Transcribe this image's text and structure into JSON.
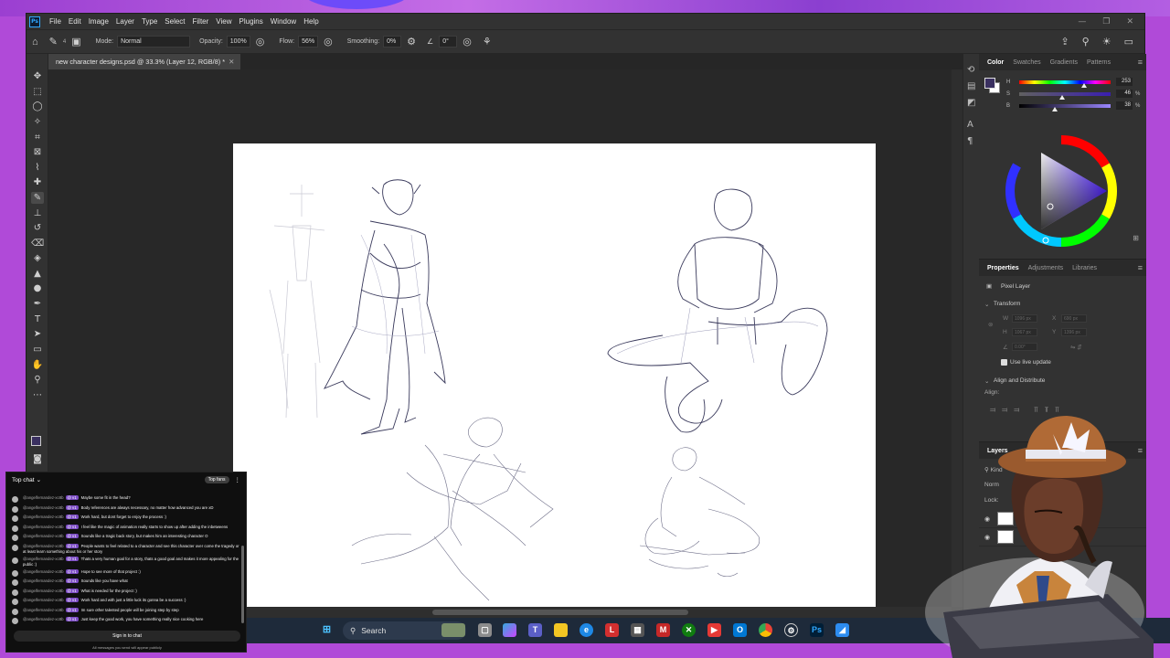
{
  "app": {
    "logo": "Ps",
    "menu": [
      "File",
      "Edit",
      "Image",
      "Layer",
      "Type",
      "Select",
      "Filter",
      "View",
      "Plugins",
      "Window",
      "Help"
    ],
    "window_controls": [
      "—",
      "❐",
      "✕"
    ]
  },
  "options_bar": {
    "brush_size": "4",
    "mode_label": "Mode:",
    "mode_value": "Normal",
    "opacity_label": "Opacity:",
    "opacity_value": "100%",
    "flow_label": "Flow:",
    "flow_value": "56%",
    "smoothing_label": "Smoothing:",
    "smoothing_value": "0%",
    "angle_value": "0°"
  },
  "document": {
    "tab_title": "new character designs.psd @ 33.3% (Layer 12, RGB/8) *"
  },
  "color_panel": {
    "tabs": [
      "Color",
      "Swatches",
      "Gradients",
      "Patterns"
    ],
    "active_tab": "Color",
    "foreground_color": "#3a3060",
    "hsb": [
      {
        "label": "H",
        "value": "253",
        "unit": ""
      },
      {
        "label": "S",
        "value": "46",
        "unit": "%"
      },
      {
        "label": "B",
        "value": "38",
        "unit": "%"
      }
    ]
  },
  "properties_panel": {
    "tabs": [
      "Properties",
      "Adjustments",
      "Libraries"
    ],
    "active_tab": "Properties",
    "layer_kind": "Pixel Layer",
    "transform_label": "Transform",
    "w_label": "W",
    "h_label": "H",
    "x_label": "X",
    "y_label": "Y",
    "w_value": "1096 px",
    "h_value": "1067 px",
    "x_value": "690 px",
    "y_value": "1396 px",
    "angle_value": "0.00°",
    "live_update_label": "Use live update",
    "align_label": "Align and Distribute",
    "align_sub": "Align:"
  },
  "layers_panel": {
    "tab": "Layers",
    "kind_label": "Kind",
    "blend": "Norm",
    "lock_label": "Lock:"
  },
  "chat": {
    "title": "Top chat",
    "top_fans": "Top fans",
    "messages": [
      {
        "user": "@angelfernandez-xc8b",
        "badge": "@ v1",
        "text": "Maybe some fit in the head?"
      },
      {
        "user": "@angelfernandez-xc8b",
        "badge": "@ v1",
        "text": "Body references are always necessary, no matter how advanced you are xD"
      },
      {
        "user": "@angelfernandez-xc8b",
        "badge": "@ v1",
        "text": "Work hard, but dont forget to enjoy the process :)"
      },
      {
        "user": "@angelfernandez-xc8b",
        "badge": "@ v1",
        "text": "I feel like the magic of animation really starts to show up after adding the inbetweens"
      },
      {
        "user": "@angelfernandez-xc8b",
        "badge": "@ v1",
        "text": "Sounds like a tragic back story, but makes him an interesting character O"
      },
      {
        "user": "@angelfernandez-xc8b",
        "badge": "@ v1",
        "text": "People wants to feel related to a character and see this character over come the tragedy or at least learn something about his or her story"
      },
      {
        "user": "@angelfernandez-xc8b",
        "badge": "@ v1",
        "text": "Thats a very human goal for a story, thats a good goal and makes it more appealing for the public :)"
      },
      {
        "user": "@angelfernandez-xc8b",
        "badge": "@ v1",
        "text": "Hope to see more of that project :)"
      },
      {
        "user": "@angelfernandez-xc8b",
        "badge": "@ v1",
        "text": "Sounds like you have what"
      },
      {
        "user": "@angelfernandez-xc8b",
        "badge": "@ v1",
        "text": "What is needed for the project :)"
      },
      {
        "user": "@angelfernandez-xc8b",
        "badge": "@ v1",
        "text": "Work hard and with just a little luck its gonna be a success :)"
      },
      {
        "user": "@angelfernandez-xc8b",
        "badge": "@ v1",
        "text": "Im sure other talented people will be joining step by step"
      },
      {
        "user": "@angelfernandez-xc8b",
        "badge": "@ v1",
        "text": "Just keep the good work, you have something really nice cooking here"
      }
    ],
    "signin": "Sign in to chat",
    "footer": "All messages you send will appear publicly"
  },
  "taskbar": {
    "search_placeholder": "Search"
  }
}
